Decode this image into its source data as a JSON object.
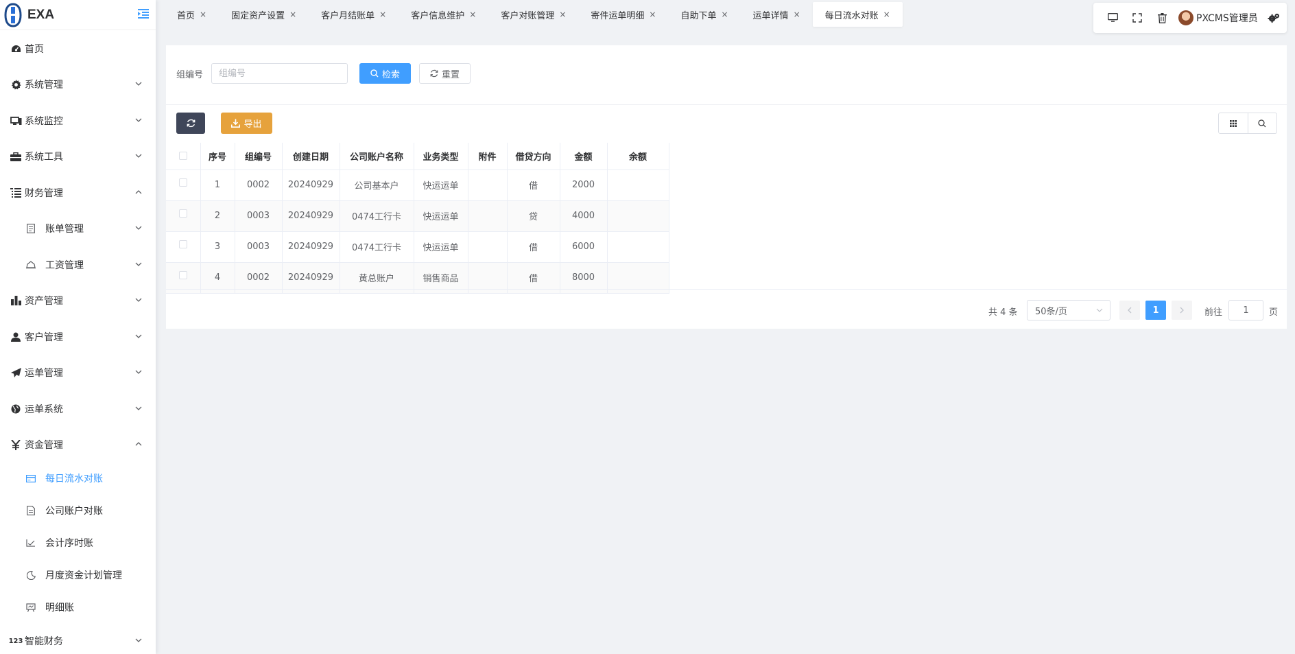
{
  "app": {
    "logo_text": "EXA"
  },
  "sidebar": {
    "items": [
      {
        "label": "首页",
        "icon": "dashboard-icon"
      },
      {
        "label": "系统管理",
        "icon": "gear-icon"
      },
      {
        "label": "系统监控",
        "icon": "monitor-icon"
      },
      {
        "label": "系统工具",
        "icon": "toolbox-icon"
      },
      {
        "label": "财务管理",
        "icon": "tree-list-icon"
      },
      {
        "label": "账单管理",
        "icon": "bill-icon"
      },
      {
        "label": "工资管理",
        "icon": "cloud-icon"
      },
      {
        "label": "资产管理",
        "icon": "bar-chart-icon"
      },
      {
        "label": "客户管理",
        "icon": "user-icon"
      },
      {
        "label": "运单管理",
        "icon": "paper-plane-icon"
      },
      {
        "label": "运单系统",
        "icon": "globe-icon"
      },
      {
        "label": "资金管理",
        "icon": "yen-icon"
      },
      {
        "label": "每日流水对账",
        "icon": "card-icon"
      },
      {
        "label": "公司账户对账",
        "icon": "document-icon"
      },
      {
        "label": "会计序时账",
        "icon": "checkmark-chart-icon"
      },
      {
        "label": "月度资金计划管理",
        "icon": "moon-icon"
      },
      {
        "label": "明细账",
        "icon": "board-icon"
      },
      {
        "label": "智能财务",
        "icon": "numbers-icon"
      }
    ]
  },
  "tabs": [
    {
      "label": "首页"
    },
    {
      "label": "固定资产设置"
    },
    {
      "label": "客户月结账单"
    },
    {
      "label": "客户信息维护"
    },
    {
      "label": "客户对账管理"
    },
    {
      "label": "寄件运单明细"
    },
    {
      "label": "自助下单"
    },
    {
      "label": "运单详情"
    },
    {
      "label": "每日流水对账"
    }
  ],
  "header": {
    "username": "PXCMS管理员"
  },
  "search": {
    "label": "组编号",
    "placeholder": "组编号",
    "search_button": "检索",
    "reset_button": "重置"
  },
  "toolbar": {
    "export_label": "导出"
  },
  "table": {
    "columns": [
      "序号",
      "组编号",
      "创建日期",
      "公司账户名称",
      "业务类型",
      "附件",
      "借贷方向",
      "金额",
      "余额"
    ],
    "rows": [
      [
        "1",
        "0002",
        "20240929",
        "公司基本户",
        "快运运单",
        "",
        "借",
        "2000",
        ""
      ],
      [
        "2",
        "0003",
        "20240929",
        "0474工行卡",
        "快运运单",
        "",
        "贷",
        "4000",
        ""
      ],
      [
        "3",
        "0003",
        "20240929",
        "0474工行卡",
        "快运运单",
        "",
        "借",
        "6000",
        ""
      ],
      [
        "4",
        "0002",
        "20240929",
        "黄总账户",
        "销售商品",
        "",
        "借",
        "8000",
        ""
      ]
    ]
  },
  "pagination": {
    "total_text": "共 4 条",
    "page_size": "50条/页",
    "current_page": "1",
    "goto_label": "前往",
    "goto_value": "1",
    "page_suffix": "页"
  },
  "colors": {
    "primary": "#409eff",
    "warning": "#e6a23c",
    "dark_button": "#3f4659"
  }
}
